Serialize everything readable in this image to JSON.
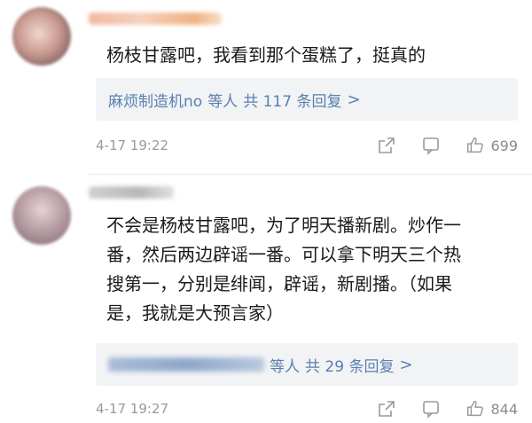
{
  "comments": [
    {
      "text": "杨枝甘露吧，我看到那个蛋糕了，挺真的",
      "reply_user": "麻烦制造机no",
      "reply_suffix": "等人",
      "reply_count_text": "共 117 条回复",
      "reply_chevron": ">",
      "time": "4-17 19:22",
      "likes": "699"
    },
    {
      "text": "不会是杨枝甘露吧，为了明天播新剧。炒作一\n番，然后两边辟谣一番。可以拿下明天三个热\n搜第一，分别是绯闻，辟谣，新剧播。（如果\n是，我就是大预言家）",
      "reply_suffix": "等人",
      "reply_count_text": "共 29 条回复",
      "reply_chevron": ">",
      "time": "4-17 19:27",
      "likes": "844"
    }
  ],
  "icons": {
    "share": "share-icon",
    "comment": "comment-icon",
    "like": "thumbs-up-icon"
  },
  "colors": {
    "link": "#5b7fb0",
    "meta": "#9a9a9a",
    "reply_bg": "#f2f3f5"
  }
}
